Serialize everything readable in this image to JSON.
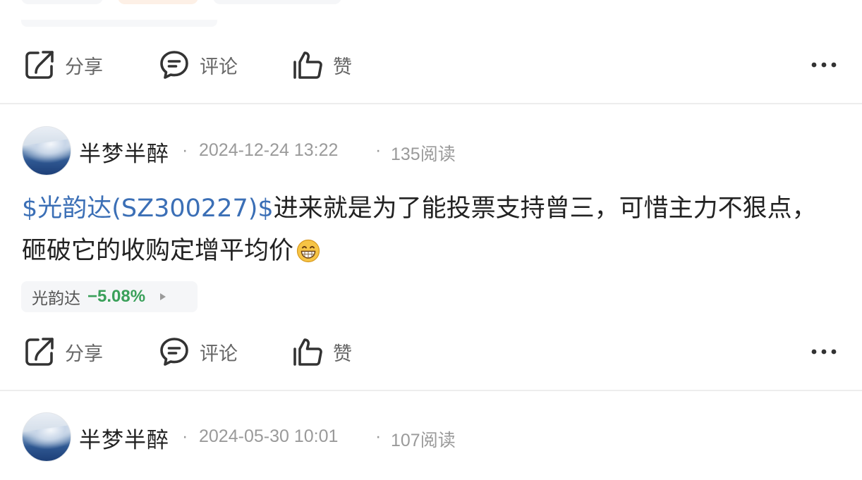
{
  "posts": [
    {
      "actions": {
        "share": "分享",
        "comment": "评论",
        "like": "赞"
      }
    },
    {
      "author": "半梦半醉",
      "date": "2024-12-24 13:22",
      "reads": "135阅读",
      "separator": "·",
      "stock_link": "$光韵达(SZ300227)$",
      "text": "进来就是为了能投票支持曾三，可惜主力不狠点，砸破它的收购定增平均价",
      "stock_tag": {
        "name": "光韵达",
        "change": "−5.08%"
      },
      "actions": {
        "share": "分享",
        "comment": "评论",
        "like": "赞"
      }
    },
    {
      "author": "半梦半醉",
      "date": "2024-05-30 10:01",
      "reads": "107阅读",
      "separator": "·"
    }
  ],
  "icons": {
    "share": "share-icon",
    "comment": "comment-icon",
    "like": "thumbs-up-icon",
    "more": "more-dots-icon",
    "emoji": "grinning-emoji-icon",
    "arrow": "play-arrow-icon"
  },
  "colors": {
    "stock_link": "#3b6fb6",
    "stock_down": "#3aa05a",
    "muted_text": "#9a9a9a"
  }
}
